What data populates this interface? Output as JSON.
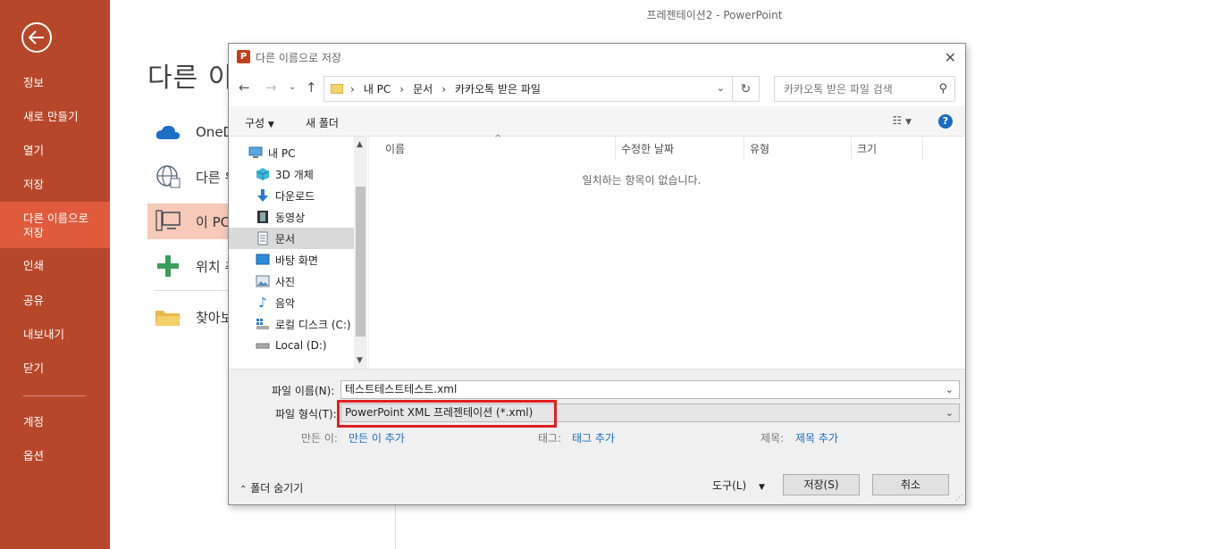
{
  "app": {
    "window_title": "프레젠테이션2 - PowerPoint",
    "page_heading": "다른 이"
  },
  "rail": {
    "items": [
      "정보",
      "새로 만들기",
      "열기",
      "저장",
      "다른 이름으로 저장",
      "인쇄",
      "공유",
      "내보내기",
      "닫기",
      "계정",
      "옵션"
    ],
    "active": "다른 이름으로 저장"
  },
  "locations": [
    "OneD",
    "다른 위",
    "이 PC",
    "위치 추",
    "찾아보"
  ],
  "dialog": {
    "title": "다른 이름으로 저장",
    "address": {
      "segments": [
        "내 PC",
        "문서",
        "카카오톡 받은 파일"
      ]
    },
    "search_placeholder": "카카오톡 받은 파일 검색",
    "toolbar": {
      "organize": "구성",
      "new_folder": "새 폴더"
    },
    "tree": [
      "내 PC",
      "3D 개체",
      "다운로드",
      "동영상",
      "문서",
      "바탕 화면",
      "사진",
      "음악",
      "로컬 디스크 (C:)",
      "Local (D:)"
    ],
    "tree_selected": "문서",
    "columns": [
      "이름",
      "수정한 날짜",
      "유형",
      "크기"
    ],
    "empty_message": "일치하는 항목이 없습니다.",
    "filename_label": "파일 이름(N):",
    "filename_value": "테스트테스트테스트.xml",
    "filetype_label": "파일 형식(T):",
    "filetype_value": "PowerPoint XML 프레젠테이션 (*.xml)",
    "meta": {
      "author_label": "만든 이:",
      "author_value": "만든 이 추가",
      "tags_label": "태그:",
      "tags_value": "태그 추가",
      "title_label": "제목:",
      "title_value": "제목 추가"
    },
    "hide_folders": "폴더 숨기기",
    "tools": "도구(L)",
    "save": "저장(S)",
    "cancel": "취소"
  },
  "colors": {
    "rail": "#b7472a",
    "rail_active": "#e05a3c",
    "accent": "#1a6bc1",
    "highlight": "#e02020"
  }
}
